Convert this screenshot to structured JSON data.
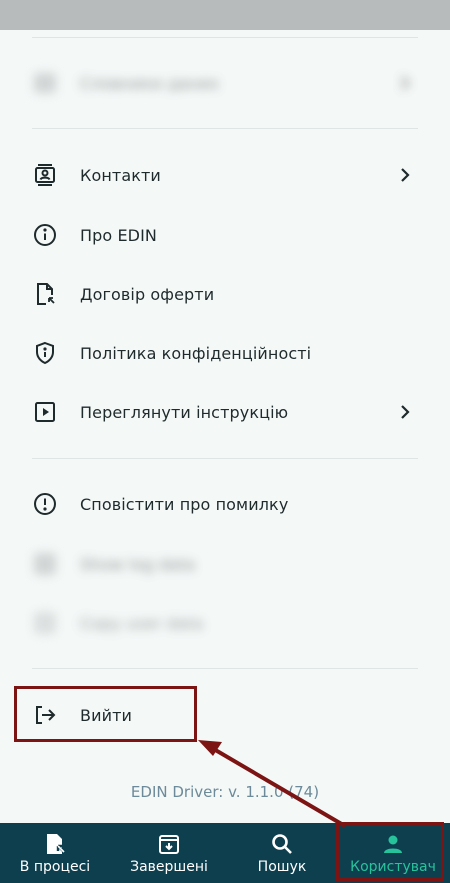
{
  "menu": {
    "blurred_top": "Словники даних",
    "contacts": "Контакти",
    "about": "Про EDIN",
    "offer": "Договір оферти",
    "privacy": "Політика конфіденційності",
    "instruction": "Переглянути інструкцію",
    "report_bug": "Сповістити про помилку",
    "show_log": "Show log data",
    "copy_user": "Copy user data",
    "logout": "Вийти"
  },
  "version": "EDIN Driver: v. 1.1.0 (74)",
  "bottom_nav": [
    {
      "label": "В процесі",
      "icon": "document-arrow-icon",
      "active": false
    },
    {
      "label": "Завершені",
      "icon": "archive-icon",
      "active": false
    },
    {
      "label": "Пошук",
      "icon": "search-icon",
      "active": false
    },
    {
      "label": "Користувач",
      "icon": "user-icon",
      "active": true
    }
  ],
  "colors": {
    "nav_bg": "#0e3f4f",
    "active": "#27c39b",
    "highlight": "#7c1414"
  }
}
